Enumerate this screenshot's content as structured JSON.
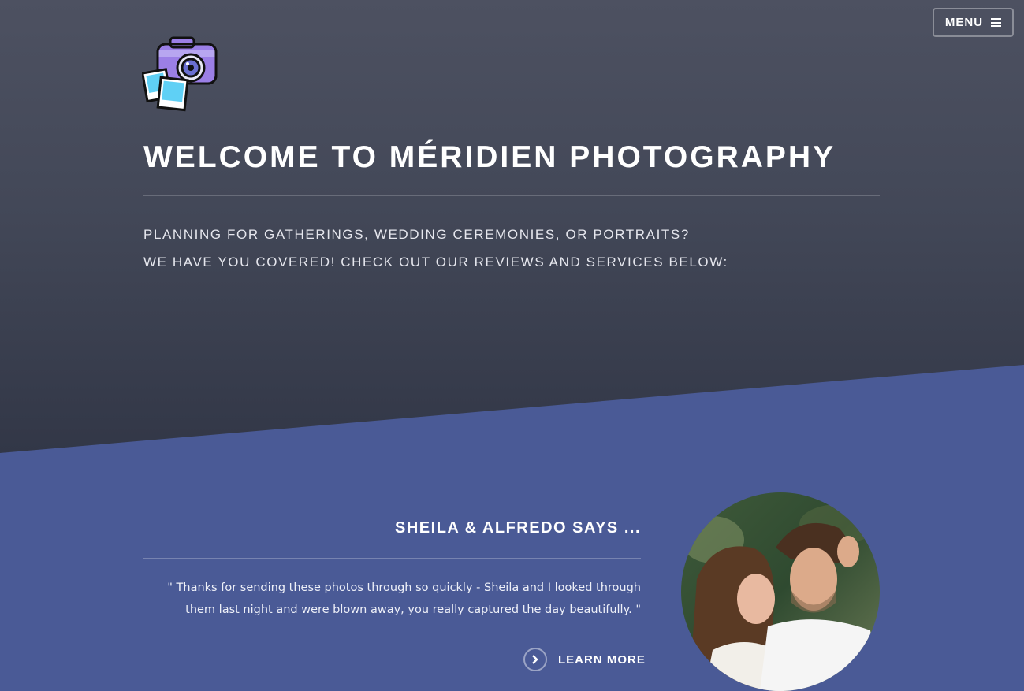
{
  "nav": {
    "menu_label": "MENU",
    "menu_icon": "hamburger-icon"
  },
  "hero": {
    "logo_icon": "camera-photos-icon",
    "title": "WELCOME TO MÉRIDIEN PHOTOGRAPHY",
    "subtitle_line1": "PLANNING FOR GATHERINGS, WEDDING CEREMONIES, OR PORTRAITS?",
    "subtitle_line2": "WE HAVE YOU COVERED! CHECK OUT OUR REVIEWS AND SERVICES BELOW:"
  },
  "testimonial": {
    "heading": "SHEILA & ALFREDO SAYS ...",
    "quote": "\" Thanks for sending these photos through so quickly - Sheila and I looked through them last night and were blown away, you really captured the day beautifully. \"",
    "cta_label": "LEARN MORE",
    "cta_icon": "chevron-right-icon",
    "image_icon": "couple-photo"
  },
  "colors": {
    "hero_top": "#4d5161",
    "hero_bottom": "#323747",
    "section_bg": "#4a5a96",
    "text": "#ffffff"
  }
}
